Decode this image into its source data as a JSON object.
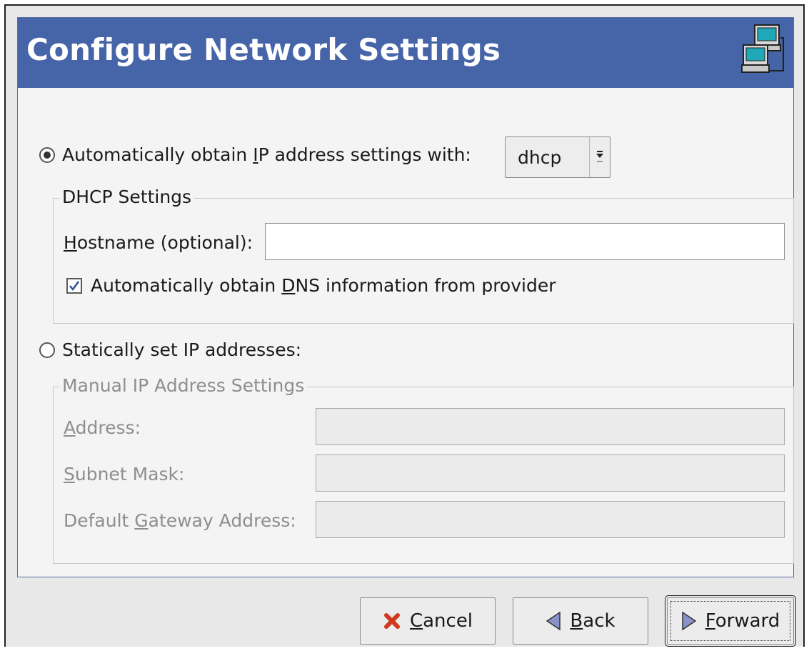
{
  "header": {
    "title": "Configure Network Settings",
    "icon": "network-computers-icon",
    "color": "#4664a8"
  },
  "auto_option": {
    "label_pre": "Automatically obtain ",
    "label_mnemonic": "I",
    "label_post": "P address settings with:",
    "selected": true,
    "method": "dhcp"
  },
  "dhcp": {
    "legend": "DHCP Settings",
    "hostname_label_mnemonic": "H",
    "hostname_label_rest": "ostname (optional):",
    "hostname_value": "",
    "dns_label_pre": "Automatically obtain ",
    "dns_label_mnemonic": "D",
    "dns_label_post": "NS information from provider",
    "dns_checked": true
  },
  "static_option": {
    "label": "Statically set IP addresses:",
    "selected": false
  },
  "manual": {
    "legend": "Manual IP Address Settings",
    "address_mnemonic": "A",
    "address_rest": "ddress:",
    "address_value": "",
    "subnet_mnemonic": "S",
    "subnet_rest": "ubnet Mask:",
    "subnet_value": "",
    "gateway_pre": "Default ",
    "gateway_mnemonic": "G",
    "gateway_post": "ateway Address:",
    "gateway_value": ""
  },
  "buttons": {
    "cancel_mnemonic": "C",
    "cancel_rest": "ancel",
    "back_mnemonic": "B",
    "back_rest": "ack",
    "forward_mnemonic": "F",
    "forward_rest": "orward"
  }
}
